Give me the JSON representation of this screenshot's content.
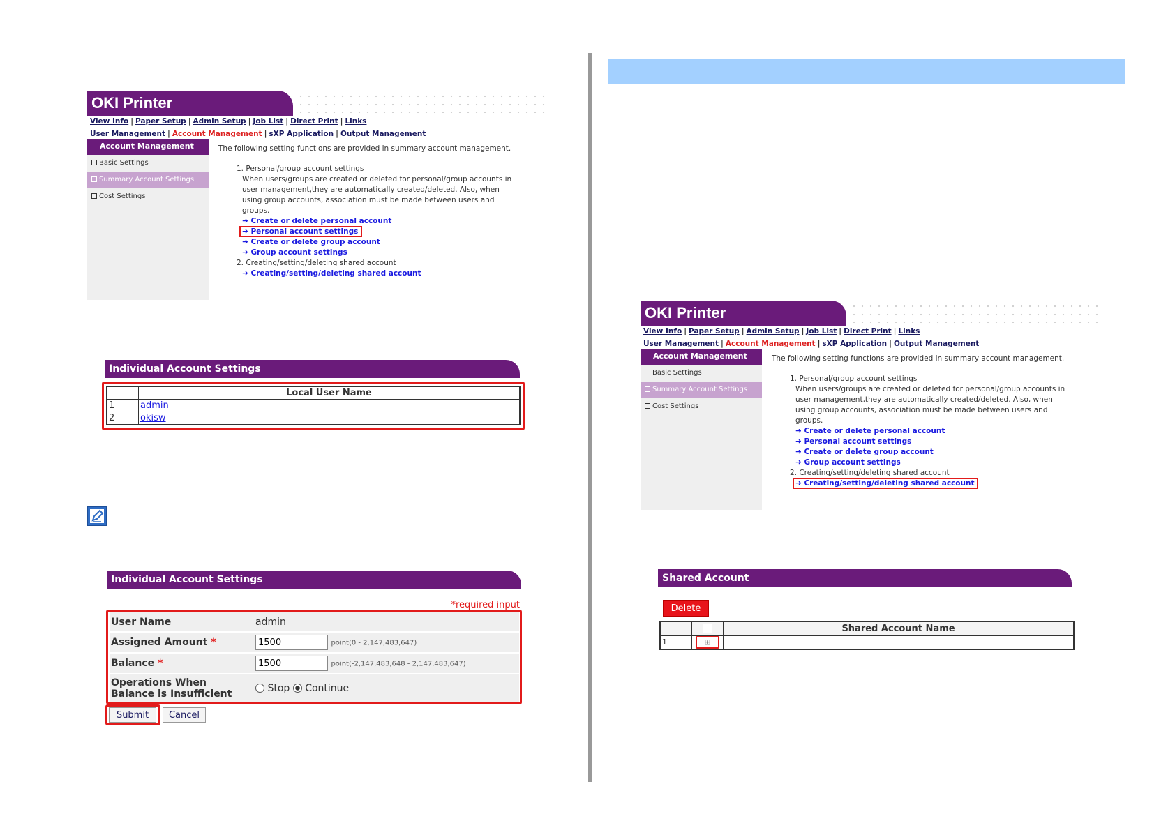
{
  "printer": {
    "title": "OKI Printer",
    "nav_row1": [
      "View Info",
      "Paper Setup",
      "Admin Setup",
      "Job List",
      "Direct Print",
      "Links"
    ],
    "nav_row2": [
      "User Management",
      "Account Management",
      "sXP Application",
      "Output Management"
    ],
    "sidebar_header": "Account Management",
    "sidebar_items": [
      "Basic Settings",
      "Summary Account Settings",
      "Cost Settings"
    ],
    "intro": "The following setting functions are provided in summary account management.",
    "section1": "1. Personal/group account settings",
    "section1_desc": [
      "When users/groups are created or deleted for personal/group accounts in",
      "user management,they are automatically created/deleted. Also, when",
      "using group accounts, association must be made between users and",
      "groups."
    ],
    "links1": [
      "Create or delete personal account",
      "Personal account settings",
      "Create or delete group account",
      "Group account settings"
    ],
    "section2": "2. Creating/setting/deleting shared account",
    "links2": [
      "Creating/setting/deleting shared account"
    ],
    "link_arrow": "➜"
  },
  "individual_list": {
    "title": "Individual Account Settings",
    "column": "Local User Name",
    "rows": [
      {
        "no": "1",
        "name": "admin"
      },
      {
        "no": "2",
        "name": "okisw"
      }
    ]
  },
  "note_icon": "pencil-note-icon",
  "individual_form": {
    "title": "Individual Account Settings",
    "required_note": "*required input",
    "user_name_label": "User Name",
    "user_name_value": "admin",
    "assigned_label": "Assigned Amount",
    "assigned_value": "1500",
    "assigned_range": "point(0 - 2,147,483,647)",
    "balance_label": "Balance",
    "balance_value": "1500",
    "balance_range": "point(-2,147,483,648 - 2,147,483,647)",
    "ops_label_1": "Operations When",
    "ops_label_2": "Balance is Insufficient",
    "opt_stop": "Stop",
    "opt_continue": "Continue",
    "asterisk": "*",
    "submit": "Submit",
    "cancel": "Cancel"
  },
  "shared": {
    "title": "Shared Account",
    "delete": "Delete",
    "column": "Shared Account Name",
    "row_no": "1",
    "expand_glyph": "⊞"
  },
  "colors": {
    "purple": "#6a1b7a",
    "highlight_red": "#e21b1b",
    "banner_blue": "#a3d0ff"
  }
}
